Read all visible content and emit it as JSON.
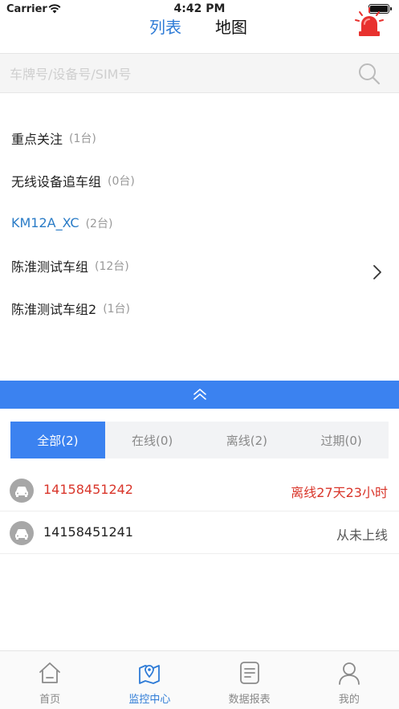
{
  "status_bar": {
    "carrier": "Carrier",
    "time": "4:42 PM"
  },
  "nav": {
    "tabs": [
      {
        "label": "列表",
        "active": true
      },
      {
        "label": "地图",
        "active": false
      }
    ]
  },
  "search": {
    "placeholder": "车牌号/设备号/SIM号",
    "value": ""
  },
  "groups": [
    {
      "name": "重点关注",
      "count": "(1台)"
    },
    {
      "name": "无线设备追车组",
      "count": "(0台)"
    },
    {
      "name": "KM12A_XC",
      "count": "(2台)"
    },
    {
      "name": "陈淮测试车组",
      "count": "(12台)"
    },
    {
      "name": "陈淮测试车组2",
      "count": "(1台)"
    }
  ],
  "filter_tabs": [
    {
      "label": "全部(2)",
      "active": true
    },
    {
      "label": "在线(0)",
      "active": false
    },
    {
      "label": "离线(2)",
      "active": false
    },
    {
      "label": "过期(0)",
      "active": false
    }
  ],
  "vehicles": [
    {
      "id": "14158451242",
      "status": "离线27天23小时"
    },
    {
      "id": "14158451241",
      "status": "从未上线"
    }
  ],
  "tab_bar": [
    {
      "label": "首页",
      "icon": "home-icon"
    },
    {
      "label": "监控中心",
      "icon": "map-pin-icon",
      "active": true
    },
    {
      "label": "数据报表",
      "icon": "report-icon"
    },
    {
      "label": "我的",
      "icon": "user-icon"
    }
  ],
  "colors": {
    "accent": "#3b82f0",
    "nav_active": "#2e7bd6",
    "highlight_group": "#2a7cc7",
    "offline_status": "#d9362b",
    "alarm": "#e8312e"
  }
}
